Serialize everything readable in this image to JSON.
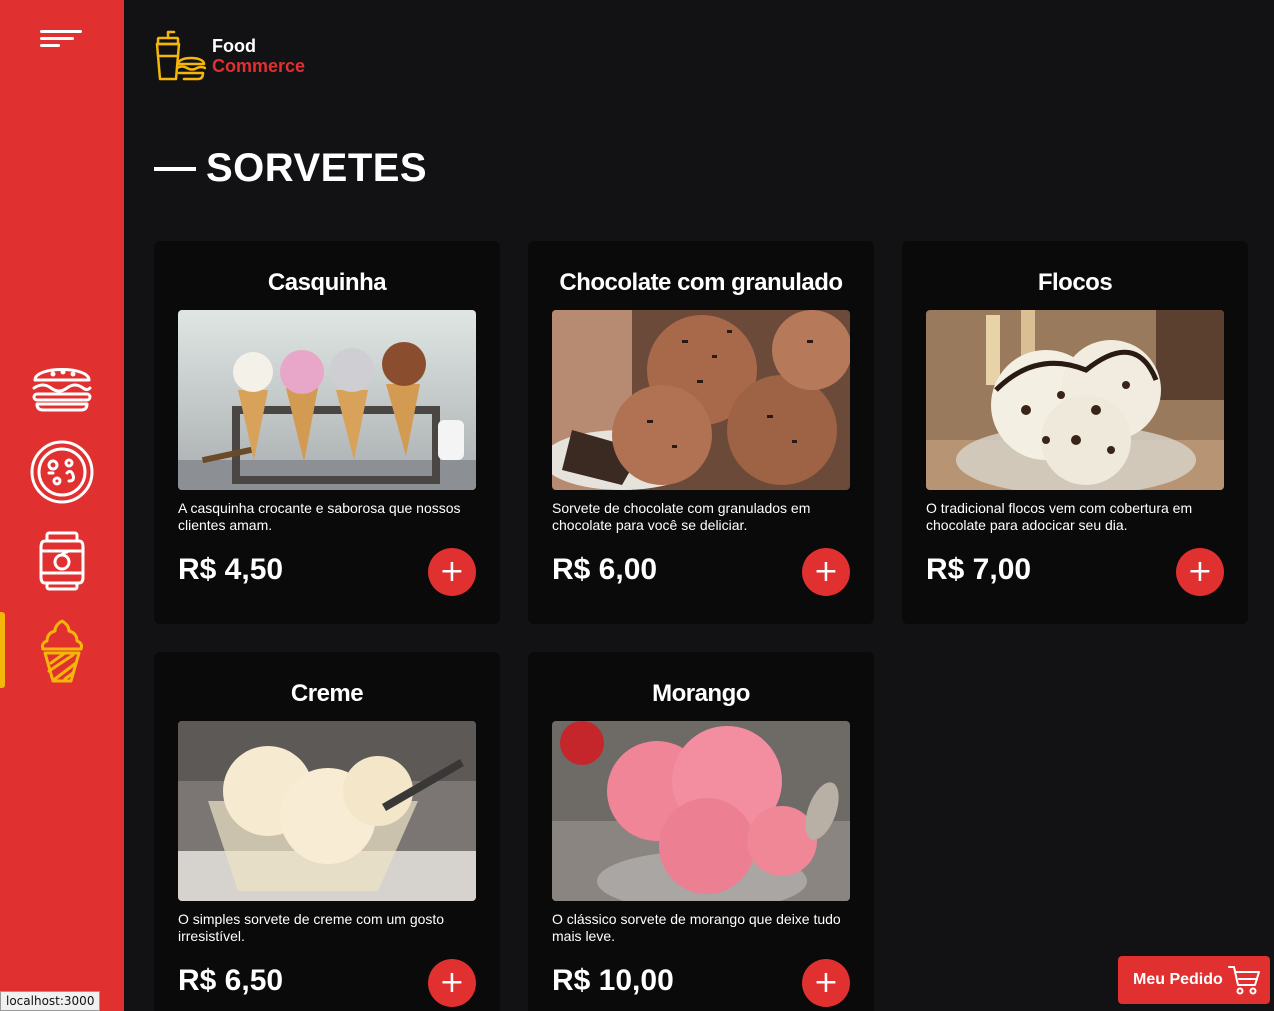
{
  "app": {
    "logo_line1": "Food",
    "logo_line2": "Commerce"
  },
  "colors": {
    "brand_red": "#e03030",
    "accent_yellow": "#f5b60a",
    "background": "#121214",
    "card": "#0a0a0b"
  },
  "sidebar": {
    "items": [
      {
        "name": "burger",
        "icon": "burger-icon",
        "active": false
      },
      {
        "name": "pizza",
        "icon": "pizza-icon",
        "active": false
      },
      {
        "name": "drinks",
        "icon": "drink-icon",
        "active": false
      },
      {
        "name": "ice-cream",
        "icon": "ice-cream-icon",
        "active": true
      }
    ]
  },
  "section": {
    "title": "SORVETES"
  },
  "products": [
    {
      "name": "Casquinha",
      "description": "A casquinha crocante e saborosa que nossos clientes amam.",
      "price": "R$ 4,50",
      "image": "ice cream cones in stand"
    },
    {
      "name": "Chocolate com granulado",
      "description": "Sorvete de chocolate com granulados em chocolate para você se deliciar.",
      "price": "R$ 6,00",
      "image": "chocolate ice cream scoops"
    },
    {
      "name": "Flocos",
      "description": "O tradicional flocos vem com cobertura em chocolate para adocicar seu dia.",
      "price": "R$ 7,00",
      "image": "flocos ice cream in glass bowl"
    },
    {
      "name": "Creme",
      "description": "O simples sorvete de creme com um gosto irresistível.",
      "price": "R$ 6,50",
      "image": "vanilla cream ice cream in glass"
    },
    {
      "name": "Morango",
      "description": "O clássico sorvete de morango que deixe tudo mais leve.",
      "price": "R$ 10,00",
      "image": "strawberry ice cream in bowl"
    }
  ],
  "add_button_label": "+",
  "order": {
    "label": "Meu Pedido"
  },
  "status_bar": {
    "url": "localhost:3000"
  }
}
